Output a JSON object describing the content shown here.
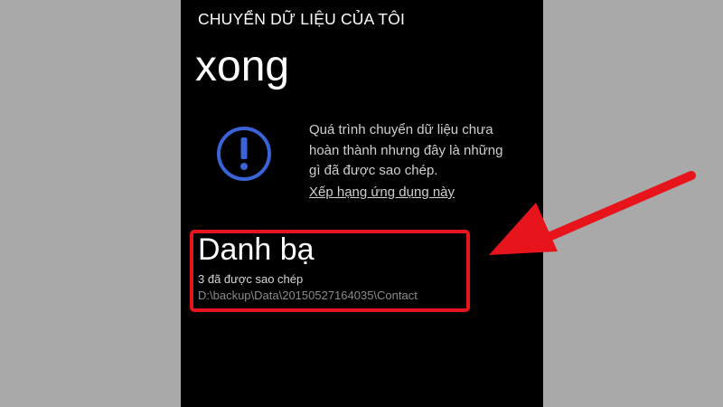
{
  "header": {
    "app_title": "CHUYỂN DỮ LIỆU CỦA TÔI",
    "page_title": "xong"
  },
  "notice": {
    "icon": "exclamation-circle-icon",
    "icon_color": "#3a63d8",
    "lines": [
      "Quá trình chuyển dữ liệu chưa",
      "hoàn thành nhưng đây là những",
      "gì đã được sao chép."
    ],
    "link_text": "Xếp hạng ứng dụng này"
  },
  "items": [
    {
      "title": "Danh bạ",
      "status": "3 đã được sao chép",
      "path": "D:\\backup\\Data\\20150527164035\\Contact"
    }
  ],
  "annotation": {
    "color": "#e8141c"
  }
}
